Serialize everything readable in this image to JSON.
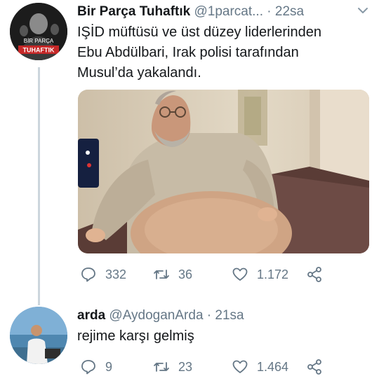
{
  "tweets": [
    {
      "display_name": "Bir Parça Tuhaftık",
      "handle": "@1parcat...",
      "separator": "·",
      "time": "22sa",
      "text_lines": [
        "IŞİD müftüsü ve üst düzey liderlerinden",
        "Ebu Abdülbari, Irak polisi tarafından",
        "Musul’da yakalandı."
      ],
      "avatar_text": [
        "BİR PARÇA",
        "TUHAFTIK"
      ],
      "replies": "332",
      "retweets": "36",
      "likes": "1.172"
    },
    {
      "display_name": "arda",
      "handle": "@AydoganArda",
      "separator": "·",
      "time": "21sa",
      "text": "rejime karşı gelmiş",
      "replies": "9",
      "retweets": "23",
      "likes": "1.464"
    }
  ],
  "colors": {
    "text": "#14171a",
    "secondary": "#657786",
    "thread_line": "#ccd6dd",
    "badge_red": "#c62828"
  },
  "icons": [
    "reply-icon",
    "retweet-icon",
    "like-icon",
    "share-icon",
    "chevron-down-icon"
  ]
}
